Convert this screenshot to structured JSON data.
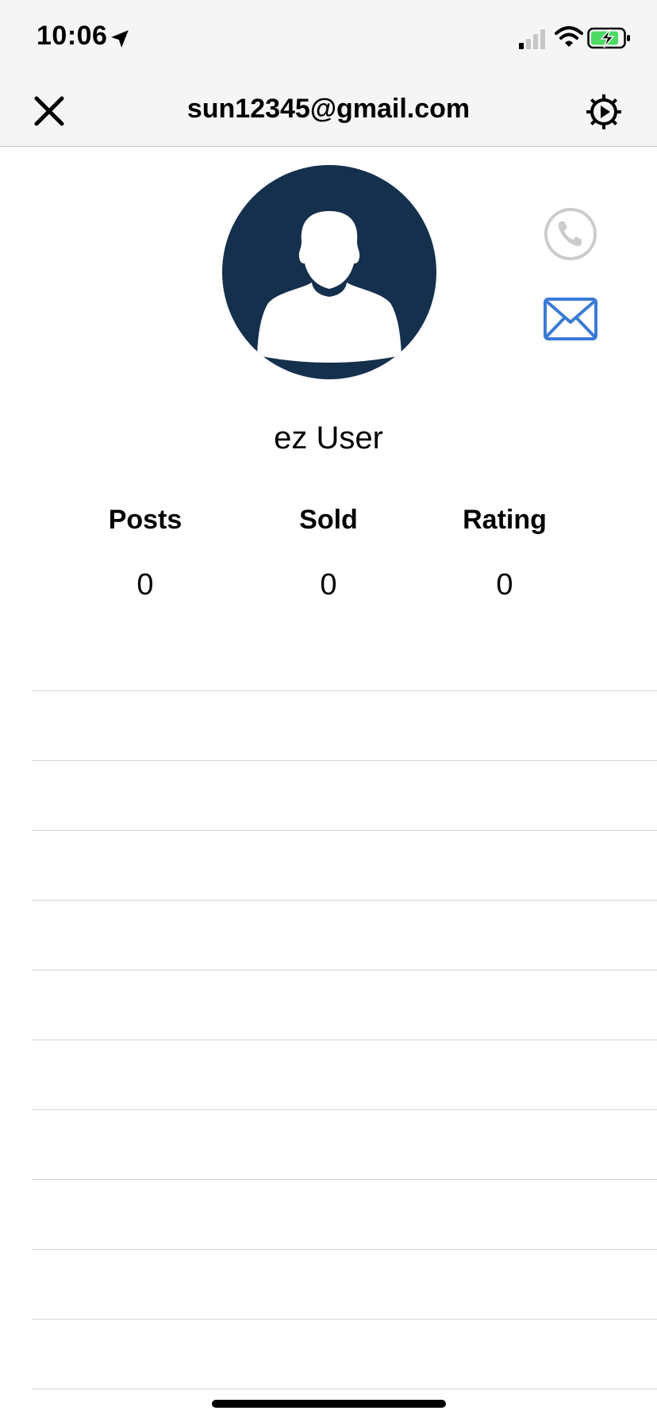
{
  "status_bar": {
    "time": "10:06",
    "icons": [
      "location-arrow-icon",
      "cellular-signal-icon",
      "wifi-icon",
      "battery-charging-icon"
    ]
  },
  "nav": {
    "title": "sun12345@gmail.com",
    "left_icon": "close-icon",
    "right_icon": "settings-gear-icon"
  },
  "profile": {
    "avatar_icon": "default-user-avatar-icon",
    "name": "ez User",
    "contact_icons": [
      "phone-icon",
      "mail-icon"
    ],
    "colors": {
      "avatar_bg": "#15304d",
      "phone_icon": "#cccccc",
      "mail_icon": "#3a7bd5"
    }
  },
  "stats": [
    {
      "label": "Posts",
      "value": "0"
    },
    {
      "label": "Sold",
      "value": "0"
    },
    {
      "label": "Rating",
      "value": "0"
    }
  ],
  "list": {
    "row_count": 10
  }
}
